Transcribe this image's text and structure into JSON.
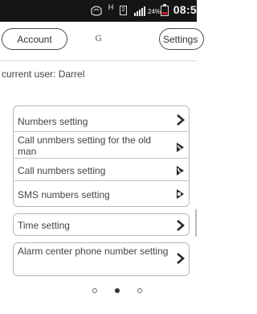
{
  "status_bar": {
    "time": "08:5",
    "battery_percent": "24%",
    "sim_label": "2",
    "network_label": "H",
    "battery_level": 0.24,
    "battery_color": "#e0191e"
  },
  "header": {
    "account_label": "Account",
    "title": "G",
    "settings_label": "Settings"
  },
  "current_user_text": "current user: Darrel",
  "groups": [
    {
      "items": [
        {
          "label": "Numbers setting",
          "icon": "chevron-right-icon"
        },
        {
          "label": "Call unmbers setting for the old man",
          "icon": "phone-arrow-icon"
        },
        {
          "label": "Call numbers setting",
          "icon": "phone-arrow-icon"
        },
        {
          "label": "SMS numbers setting",
          "icon": "message-arrow-icon"
        }
      ]
    },
    {
      "items": [
        {
          "label": "Time setting",
          "icon": "chevron-right-icon"
        }
      ]
    },
    {
      "items": [
        {
          "label": "Alarm center phone number setting",
          "icon": "chevron-right-icon"
        }
      ]
    }
  ],
  "pager": {
    "total": 3,
    "current": 2
  }
}
